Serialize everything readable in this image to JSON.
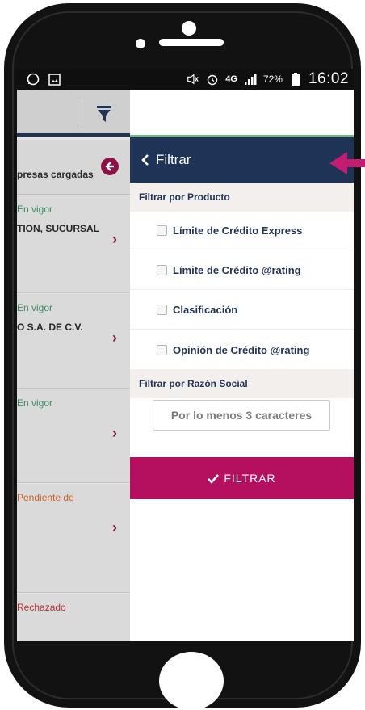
{
  "status_bar": {
    "battery": "72%",
    "network": "4G",
    "time": "16:02"
  },
  "background_list": {
    "summary": "presas cargadas",
    "cards": [
      {
        "status": "En vigor",
        "company": "TION, SUCURSAL"
      },
      {
        "status": "En vigor",
        "company": "O S.A. DE C.V."
      },
      {
        "status": "En vigor",
        "company": ""
      },
      {
        "status": "Pendiente de",
        "company": ""
      },
      {
        "status": "Rechazado",
        "company": ""
      }
    ]
  },
  "drawer": {
    "title": "Filtrar",
    "section_product": "Filtrar por Producto",
    "options": [
      "Límite de Crédito Express",
      "Límite de Crédito @rating",
      "Clasificación",
      "Opinión de Crédito @rating"
    ],
    "section_social": "Filtrar por Razón Social",
    "search_placeholder": "Por lo menos 3 caracteres",
    "filter_button": "FILTRAR"
  },
  "colors": {
    "header_navy": "#1f3356",
    "accent_magenta": "#b5105f",
    "section_bg": "#f3efec"
  }
}
